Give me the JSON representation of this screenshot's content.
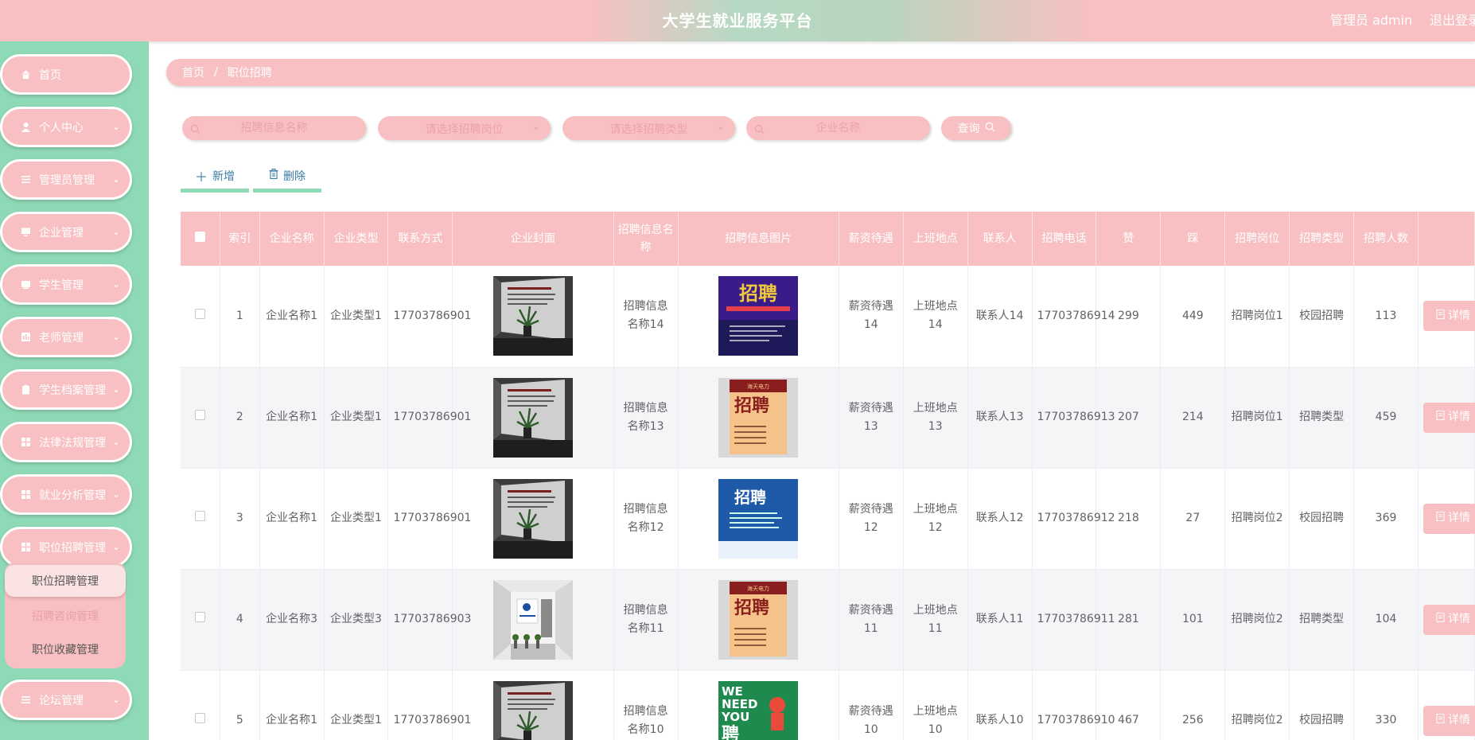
{
  "header": {
    "title": "大学生就业服务平台",
    "user": "管理员 admin",
    "logout": "退出登录"
  },
  "sidebar": {
    "items": [
      {
        "label": "首页",
        "icon": "home-icon",
        "has_children": false
      },
      {
        "label": "个人中心",
        "icon": "user-icon",
        "has_children": true
      },
      {
        "label": "管理员管理",
        "icon": "menu-icon",
        "has_children": true
      },
      {
        "label": "企业管理",
        "icon": "monitor-icon",
        "has_children": true
      },
      {
        "label": "学生管理",
        "icon": "notebook-icon",
        "has_children": true
      },
      {
        "label": "老师管理",
        "icon": "chart-icon",
        "has_children": true
      },
      {
        "label": "学生档案管理",
        "icon": "clipboard-icon",
        "has_children": true
      },
      {
        "label": "法律法规管理",
        "icon": "grid-icon",
        "has_children": true
      },
      {
        "label": "就业分析管理",
        "icon": "grid-icon",
        "has_children": true
      },
      {
        "label": "职位招聘管理",
        "icon": "grid-icon",
        "has_children": true
      },
      {
        "label": "论坛管理",
        "icon": "menu-icon",
        "has_children": true
      }
    ],
    "submenu": [
      "职位招聘管理",
      "招聘咨询管理",
      "职位收藏管理"
    ]
  },
  "breadcrumb": {
    "home": "首页",
    "sep": "/",
    "current": "职位招聘"
  },
  "search": {
    "name_placeholder": "招聘信息名称",
    "position_placeholder": "请选择招聘岗位",
    "type_placeholder": "请选择招聘类型",
    "company_placeholder": "企业名称",
    "query_label": "查询"
  },
  "actions": {
    "add": "新增",
    "delete": "删除"
  },
  "table": {
    "headers": [
      "索引",
      "企业名称",
      "企业类型",
      "联系方式",
      "企业封面",
      "招聘信息名称",
      "招聘信息图片",
      "薪资待遇",
      "上班地点",
      "联系人",
      "招聘电话",
      "赞",
      "踩",
      "招聘岗位",
      "招聘类型",
      "招聘人数",
      ""
    ],
    "detail_label": "详情",
    "rows": [
      {
        "idx": "1",
        "company": "企业名称1",
        "ctype": "企业类型1",
        "contact": "17703786901",
        "cover": "office",
        "name": "招聘信息名称14",
        "poster": "purple",
        "salary": "薪资待遇14",
        "place": "上班地点14",
        "person": "联系人14",
        "phone": "17703786914",
        "up": "299",
        "down": "449",
        "post": "招聘岗位1",
        "rtype": "校园招聘",
        "count": "113"
      },
      {
        "idx": "2",
        "company": "企业名称1",
        "ctype": "企业类型1",
        "contact": "17703786901",
        "cover": "office",
        "name": "招聘信息名称13",
        "poster": "scroll",
        "salary": "薪资待遇13",
        "place": "上班地点13",
        "person": "联系人13",
        "phone": "17703786913",
        "up": "207",
        "down": "214",
        "post": "招聘岗位1",
        "rtype": "招聘类型",
        "count": "459"
      },
      {
        "idx": "3",
        "company": "企业名称1",
        "ctype": "企业类型1",
        "contact": "17703786901",
        "cover": "office",
        "name": "招聘信息名称12",
        "poster": "blue",
        "salary": "薪资待遇12",
        "place": "上班地点12",
        "person": "联系人12",
        "phone": "17703786912",
        "up": "218",
        "down": "27",
        "post": "招聘岗位2",
        "rtype": "校园招聘",
        "count": "369"
      },
      {
        "idx": "4",
        "company": "企业名称3",
        "ctype": "企业类型3",
        "contact": "17703786903",
        "cover": "lobby",
        "name": "招聘信息名称11",
        "poster": "scroll",
        "salary": "薪资待遇11",
        "place": "上班地点11",
        "person": "联系人11",
        "phone": "17703786911",
        "up": "281",
        "down": "101",
        "post": "招聘岗位2",
        "rtype": "招聘类型",
        "count": "104"
      },
      {
        "idx": "5",
        "company": "企业名称1",
        "ctype": "企业类型1",
        "contact": "17703786901",
        "cover": "office",
        "name": "招聘信息名称10",
        "poster": "green",
        "salary": "薪资待遇10",
        "place": "上班地点10",
        "person": "联系人10",
        "phone": "17703786910",
        "up": "467",
        "down": "256",
        "post": "招聘岗位2",
        "rtype": "校园招聘",
        "count": "330"
      }
    ]
  },
  "poster_text": {
    "purple": "招聘",
    "scroll_head": "海天电力",
    "scroll": "招聘",
    "blue": "招聘",
    "green_1": "WE",
    "green_2": "NEED",
    "green_3": "YOU",
    "green_4": "聘"
  },
  "colors": {
    "pink": "#f8c0c2",
    "green": "#8fdab6",
    "link": "#3a7ca5"
  }
}
